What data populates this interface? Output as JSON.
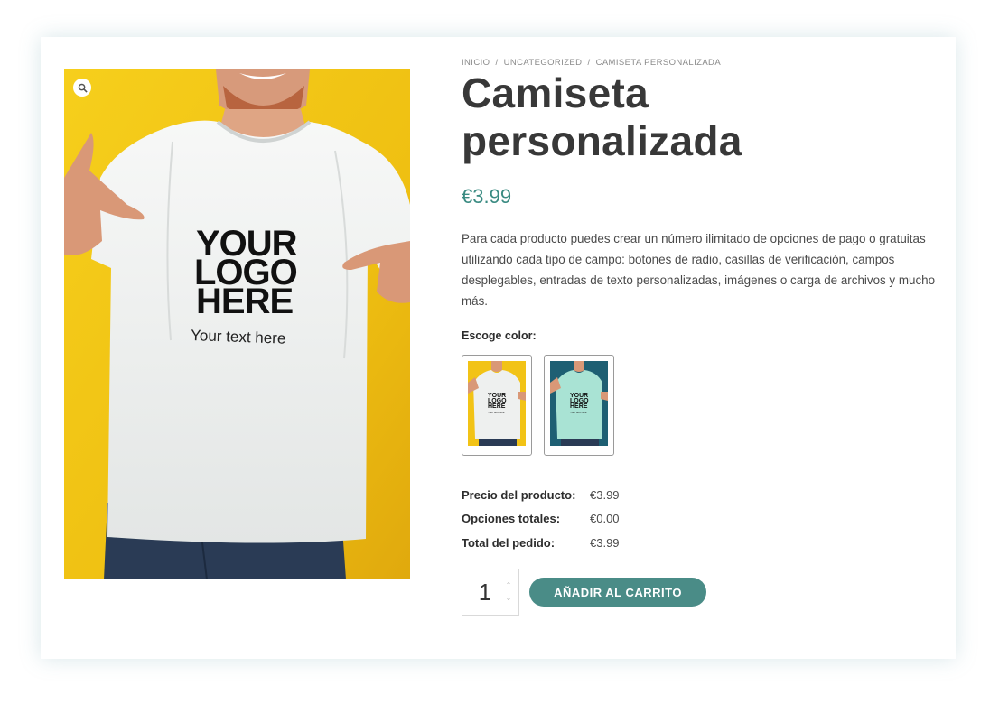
{
  "breadcrumb": {
    "home": "INICIO",
    "separator": "/",
    "category": "UNCATEGORIZED",
    "current": "CAMISETA PERSONALIZADA"
  },
  "product": {
    "title": "Camiseta personalizada",
    "price": "€3.99",
    "description": "Para cada producto puedes crear un número ilimitado de opciones de pago o gratuitas utilizando cada tipo de campo: botones de radio, casillas de verificación, campos desplegables, entradas de texto personalizadas, imágenes o carga de archivos y mucho más.",
    "shirt_print": {
      "line1": "YOUR",
      "line2": "LOGO",
      "line3": "HERE",
      "line4": "Your text here"
    }
  },
  "color_option": {
    "label": "Escoge color:",
    "swatches": [
      {
        "name": "Yellow / white shirt",
        "background": "#f2c316",
        "shirt": "#f1f3f2"
      },
      {
        "name": "Teal / mint shirt",
        "background": "#1e5f73",
        "shirt": "#a9e3d4"
      }
    ]
  },
  "totals": {
    "product_price_label": "Precio del producto:",
    "product_price_value": "€3.99",
    "options_total_label": "Opciones totales:",
    "options_total_value": "€0.00",
    "order_total_label": "Total del pedido:",
    "order_total_value": "€3.99"
  },
  "cart": {
    "quantity": "1",
    "add_to_cart_label": "AÑADIR AL CARRITO"
  },
  "colors": {
    "accent": "#3a8b82",
    "button": "#4a8c87",
    "photo_background": "#f2c316"
  },
  "icons": {
    "zoom": "magnifier-icon",
    "qty_up": "chevron-up-icon",
    "qty_down": "chevron-down-icon"
  }
}
